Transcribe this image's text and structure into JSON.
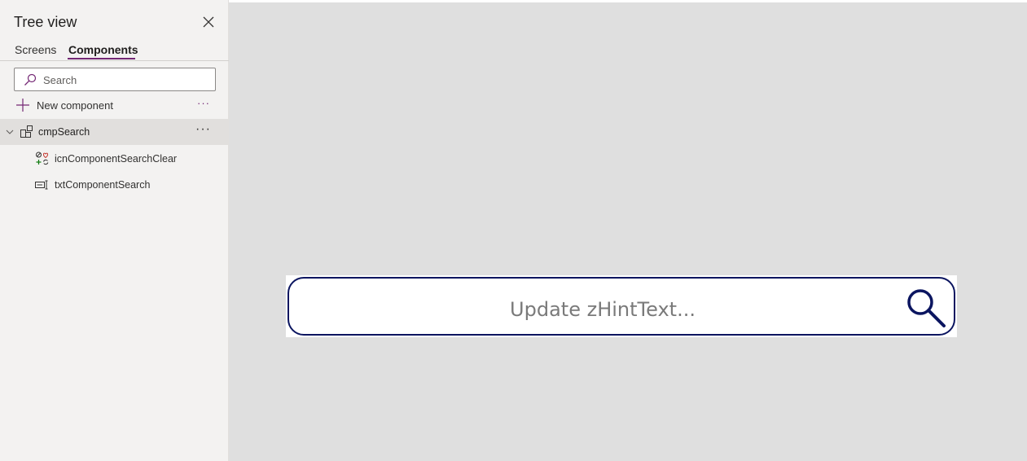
{
  "panel": {
    "title": "Tree view",
    "tabs": [
      {
        "label": "Screens",
        "active": false
      },
      {
        "label": "Components",
        "active": true
      }
    ],
    "search": {
      "placeholder": "Search",
      "value": ""
    },
    "new_component_label": "New component",
    "more_label": "···",
    "tree": {
      "component": {
        "label": "cmpSearch",
        "icon": "component-icon",
        "selected": true,
        "expanded": true
      },
      "children": [
        {
          "label": "icnComponentSearchClear",
          "icon": "icons-control-icon"
        },
        {
          "label": "txtComponentSearch",
          "icon": "text-input-control-icon"
        }
      ]
    }
  },
  "canvas": {
    "search_component": {
      "hint_text": "Update zHintText...",
      "icon": "magnifier-icon",
      "border_color": "#0b1560"
    }
  },
  "colors": {
    "accent": "#742774",
    "panel_bg": "#f3f2f1",
    "canvas_bg": "#dfdfdf",
    "selected_row": "#e1dfdd"
  }
}
